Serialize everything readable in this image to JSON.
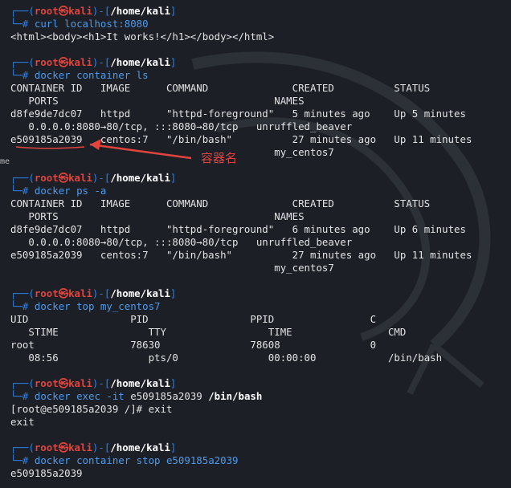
{
  "prompt": {
    "user": "root",
    "at": "㉿",
    "host": "kali",
    "dir_home": "/home/kali",
    "corner_top": "┌──(",
    "corner_mid": ")-[",
    "corner_end": "]",
    "corner_bottom": "└─#"
  },
  "blocks": [
    {
      "cmd": "curl localhost:8080",
      "output": [
        "<html><body><h1>It works!</h1></body></html>"
      ]
    },
    {
      "cmd": "docker container ls",
      "output": [
        "CONTAINER ID   IMAGE      COMMAND              CREATED          STATUS",
        "   PORTS                                    NAMES",
        "d8fe9de7dc07   httpd      \"httpd-foreground\"   5 minutes ago    Up 5 minutes",
        "   0.0.0.0:8080→80/tcp, :::8080→80/tcp   unruffled_beaver",
        "e509185a2039   centos:7   \"/bin/bash\"          27 minutes ago   Up 11 minutes",
        "                                            my_centos7"
      ]
    },
    {
      "cmd": "docker ps -a",
      "output": [
        "CONTAINER ID   IMAGE      COMMAND              CREATED          STATUS",
        "   PORTS                                    NAMES",
        "d8fe9de7dc07   httpd      \"httpd-foreground\"   6 minutes ago    Up 6 minutes",
        "   0.0.0.0:8080→80/tcp, :::8080→80/tcp   unruffled_beaver",
        "e509185a2039   centos:7   \"/bin/bash\"          27 minutes ago   Up 11 minutes",
        "                                            my_centos7"
      ]
    },
    {
      "cmd": "docker top my_centos7",
      "output": [
        "UID                 PID                 PPID                C",
        "   STIME               TTY                 TIME                CMD",
        "root                78630               78608               0",
        "   08:56               pts/0               00:00:00            /bin/bash"
      ]
    },
    {
      "cmd_parts": [
        "docker exec ",
        "-it",
        " e509185a2039 ",
        "/bin/bash"
      ],
      "output": [
        "[root@e509185a2039 /]# exit",
        "exit"
      ]
    },
    {
      "cmd": "docker container stop e509185a2039",
      "output": [
        "e509185a2039"
      ]
    }
  ],
  "annotation": {
    "label": "容器名",
    "color": "#e2443d"
  },
  "edge_fragment": "me",
  "colors": {
    "background": "#1d1f27",
    "prompt_frame": "#2f7fe0",
    "prompt_user": "#e2443d",
    "text": "#e2e2e2"
  }
}
